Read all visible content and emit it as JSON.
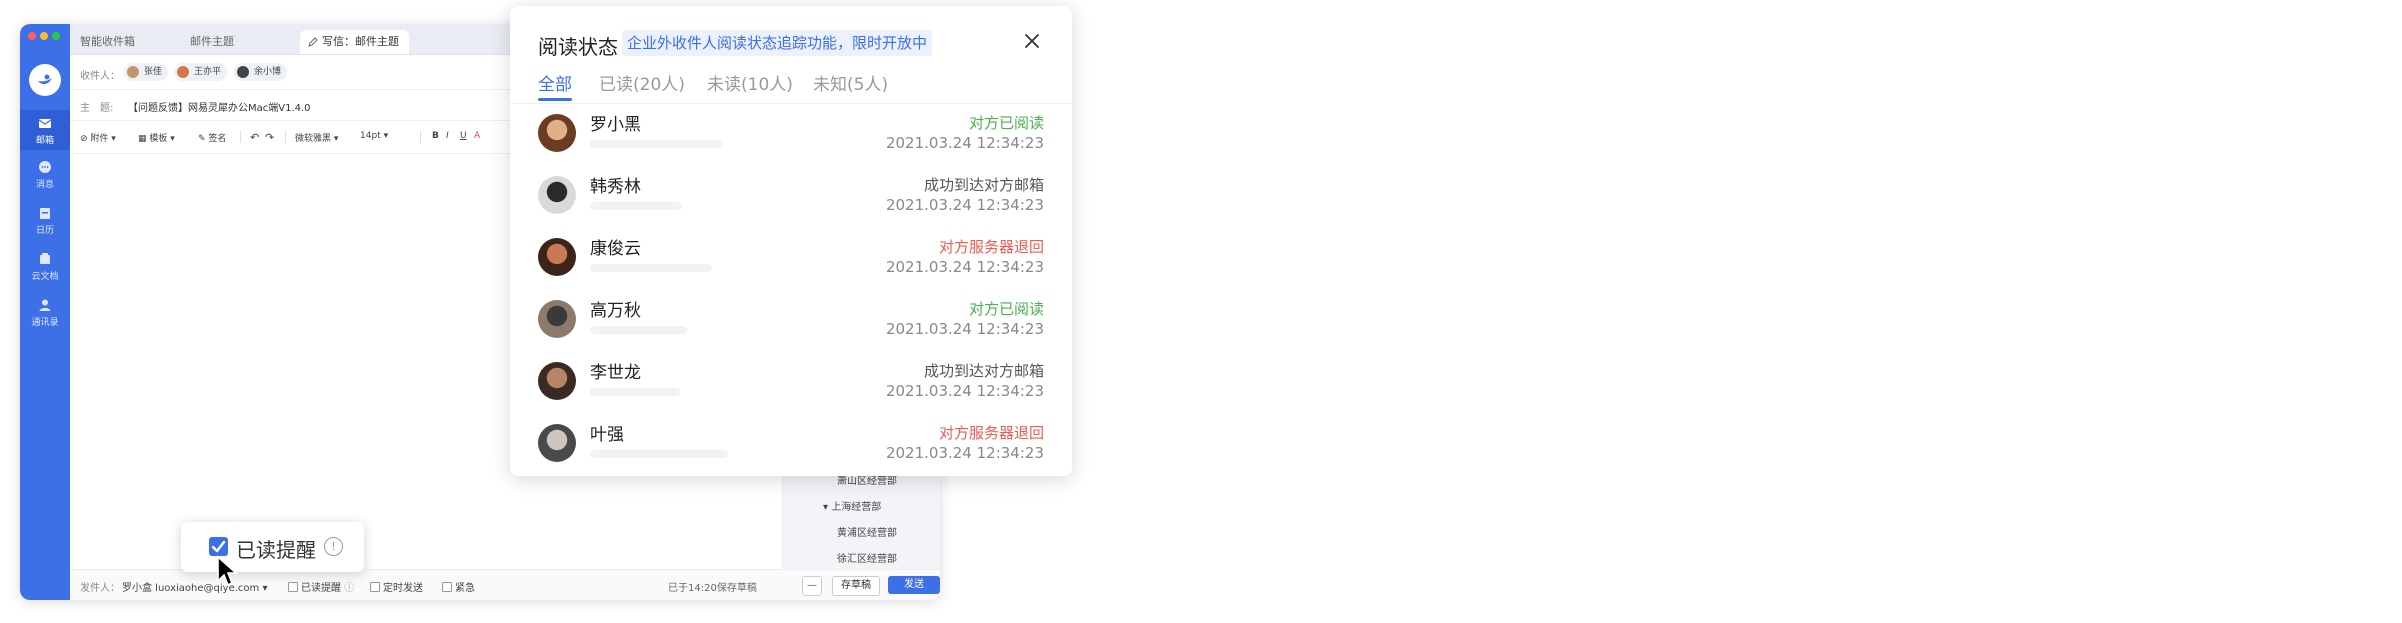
{
  "colors": {
    "accent": "#3d6fe6",
    "read": "#4caf50",
    "bounced": "#f05a4f",
    "delivered": "#555555"
  },
  "sidebar": {
    "logo_icon": "bird-logo",
    "items": [
      {
        "label": "邮箱",
        "icon": "mail-icon"
      },
      {
        "label": "消息",
        "icon": "chat-icon"
      },
      {
        "label": "日历",
        "icon": "calendar-icon"
      },
      {
        "label": "云文档",
        "icon": "cloud-doc-icon"
      },
      {
        "label": "通讯录",
        "icon": "contacts-icon"
      }
    ]
  },
  "tabs": [
    "智能收件箱",
    "邮件主题",
    "写信：邮件主题"
  ],
  "compose": {
    "to_label": "收件人：",
    "recipients": [
      "张佳",
      "王亦平",
      "余小博"
    ],
    "subject_label": "主　题:",
    "subject": "【问题反馈】网易灵犀办公Mac端V1.4.0"
  },
  "toolbar": {
    "attach": "附件",
    "template": "模板",
    "signature": "签名",
    "font": "微软雅黑",
    "size": "14pt",
    "bold": "B",
    "italic": "I",
    "underline": "U",
    "color": "A"
  },
  "org_tree": [
    "萧山区经营部",
    "上海经营部",
    "黄浦区经营部",
    "徐汇区经营部"
  ],
  "footer": {
    "sender_label": "发件人：",
    "sender": "罗小盒 luoxiaohe@qiye.com",
    "read_receipt": "已读提醒",
    "scheduled": "定时发送",
    "urgent": "紧急",
    "saved": "已于14:20保存草稿",
    "minus": "—",
    "save_draft": "存草稿",
    "send": "发送"
  },
  "callout": {
    "label": "已读提醒",
    "info": "!"
  },
  "popup": {
    "title": "阅读状态",
    "promo": "企业外收件人阅读状态追踪功能，限时开放中",
    "tabs": [
      "全部",
      "已读(20人)",
      "未读(10人)",
      "未知(5人)"
    ],
    "rows": [
      {
        "name": "罗小黑",
        "status": "对方已阅读",
        "type": "read",
        "time": "2021.03.24 12:34:23",
        "bar": 0.58
      },
      {
        "name": "韩秀林",
        "status": "成功到达对方邮箱",
        "type": "delivered",
        "time": "2021.03.24 12:34:23",
        "bar": 0.4
      },
      {
        "name": "康俊云",
        "status": "对方服务器退回",
        "type": "bounced",
        "time": "2021.03.24 12:34:23",
        "bar": 0.53
      },
      {
        "name": "高万秋",
        "status": "对方已阅读",
        "type": "read",
        "time": "2021.03.24 12:34:23",
        "bar": 0.42
      },
      {
        "name": "李世龙",
        "status": "成功到达对方邮箱",
        "type": "delivered",
        "time": "2021.03.24 12:34:23",
        "bar": 0.39
      },
      {
        "name": "叶强",
        "status": "对方服务器退回",
        "type": "bounced",
        "time": "2021.03.24 12:34:23",
        "bar": 0.6
      }
    ]
  }
}
